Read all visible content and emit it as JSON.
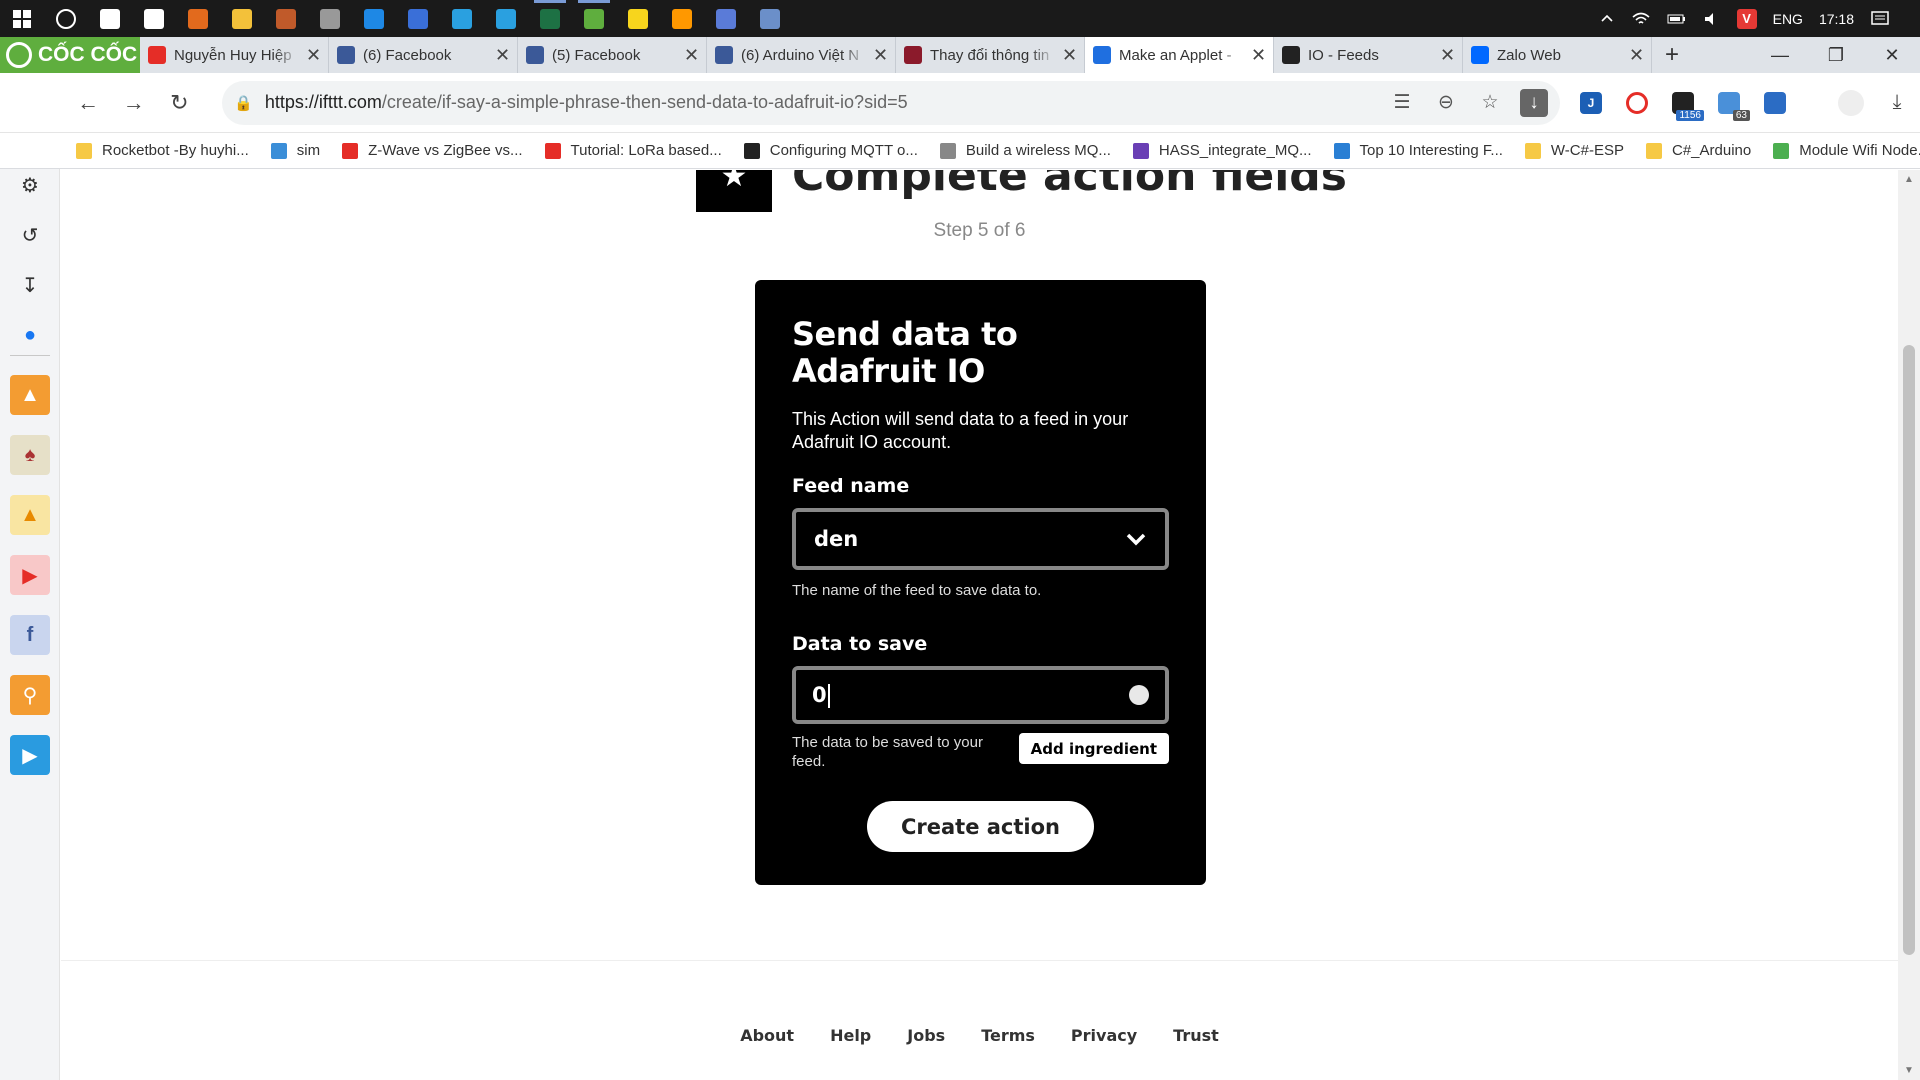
{
  "taskbar": {
    "icons": [
      {
        "name": "windows-start-icon",
        "color": "#ffffff"
      },
      {
        "name": "cortana-search-icon",
        "color": "#ffffff"
      },
      {
        "name": "task-view-icon",
        "color": "#ffffff"
      },
      {
        "name": "mail-icon",
        "color": "#ffffff"
      },
      {
        "name": "matlab-icon",
        "color": "#e26a1d"
      },
      {
        "name": "file-explorer-icon",
        "color": "#f3c13a"
      },
      {
        "name": "app-icon",
        "color": "#c05a2a"
      },
      {
        "name": "usb-icon",
        "color": "#999999"
      },
      {
        "name": "edge-icon",
        "color": "#1e88e5"
      },
      {
        "name": "app-icon",
        "color": "#3a6fd8"
      },
      {
        "name": "app-icon",
        "color": "#2aa0e0"
      },
      {
        "name": "telegram-icon",
        "color": "#2aa0e0"
      },
      {
        "name": "excel-icon",
        "color": "#1d7144"
      },
      {
        "name": "coccoc-icon",
        "color": "#5fae3e"
      },
      {
        "name": "sticky-notes-icon",
        "color": "#f7d51d"
      },
      {
        "name": "sublime-icon",
        "color": "#ff9800"
      },
      {
        "name": "app-icon",
        "color": "#5a7bd8"
      },
      {
        "name": "app-icon",
        "color": "#6b8fc9"
      }
    ],
    "language": "ENG",
    "clock": "17:18"
  },
  "browser": {
    "brand": "CỐC CỐC",
    "tabs": [
      {
        "title": "Nguyễn Huy Hiệp",
        "fav_color": "#e52d27",
        "active": false
      },
      {
        "title": "(6) Facebook",
        "fav_color": "#3b5998",
        "active": false
      },
      {
        "title": "(5) Facebook",
        "fav_color": "#3b5998",
        "active": false
      },
      {
        "title": "(6) Arduino Việt N",
        "fav_color": "#3b5998",
        "active": false
      },
      {
        "title": "Thay đổi thông tin",
        "fav_color": "#8b1a2b",
        "active": false
      },
      {
        "title": "Make an Applet -",
        "fav_color": "#1f6fe0",
        "active": true
      },
      {
        "title": "IO - Feeds",
        "fav_color": "#222222",
        "active": false
      },
      {
        "title": "Zalo Web",
        "fav_color": "#0068ff",
        "active": false
      }
    ],
    "url_host": "https://ifttt.com",
    "url_path": "/create/if-say-a-simple-phrase-then-send-data-to-adafruit-io?sid=5",
    "extension_badges": {
      "first": "1156",
      "second": "63"
    },
    "bookmarks": [
      {
        "label": "Rocketbot -By huyhi...",
        "color": "#f6c945"
      },
      {
        "label": "sim",
        "color": "#3b8ed8"
      },
      {
        "label": "Z-Wave vs ZigBee vs...",
        "color": "#e52d27"
      },
      {
        "label": "Tutorial: LoRa based...",
        "color": "#e52d27"
      },
      {
        "label": "Configuring MQTT o...",
        "color": "#222222"
      },
      {
        "label": "Build a wireless MQ...",
        "color": "#888888"
      },
      {
        "label": "HASS_integrate_MQ...",
        "color": "#6a3fb5"
      },
      {
        "label": "Top 10 Interesting F...",
        "color": "#2a7fd4"
      },
      {
        "label": "W-C#-ESP",
        "color": "#f6c945"
      },
      {
        "label": "C#_Arduino",
        "color": "#f6c945"
      },
      {
        "label": "Module Wifi Node...",
        "color": "#4caf50"
      }
    ]
  },
  "page": {
    "heading": "Complete action fields",
    "step": "Step 5 of 6",
    "card": {
      "title": "Send data to Adafruit IO",
      "description": "This Action will send data to a feed in your Adafruit IO account.",
      "feed_label": "Feed name",
      "feed_value": "den",
      "feed_help": "The name of the feed to save data to.",
      "data_label": "Data to save",
      "data_value": "0",
      "data_help": "The data to be saved to your feed.",
      "add_ingredient": "Add ingredient",
      "create_action": "Create action"
    },
    "footer_links": [
      "About",
      "Help",
      "Jobs",
      "Terms",
      "Privacy",
      "Trust"
    ]
  }
}
